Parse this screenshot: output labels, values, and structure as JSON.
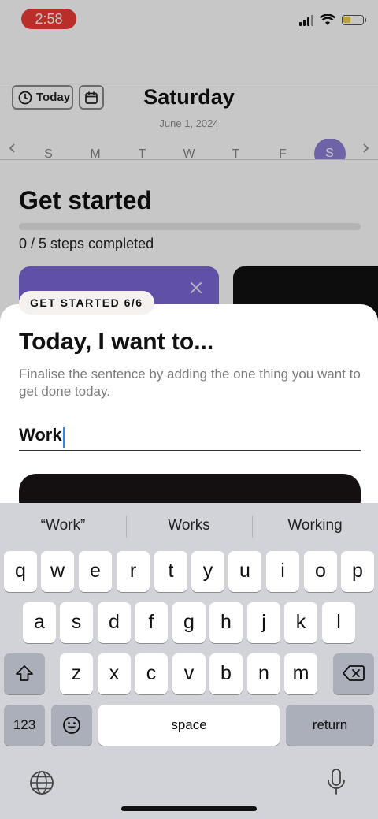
{
  "status": {
    "time": "2:58"
  },
  "header": {
    "today_label": "Today",
    "day_title": "Saturday",
    "date": "June 1, 2024",
    "week_days": [
      "S",
      "M",
      "T",
      "W",
      "T",
      "F",
      "S"
    ],
    "prev_icon": "chevron-left-icon",
    "next_icon": "chevron-right-icon"
  },
  "get_started": {
    "title": "Get started",
    "progress_fraction": 0,
    "steps_text": "0 / 5 steps completed"
  },
  "sheet": {
    "badge": "GET STARTED 6/6",
    "title": "Today, I want to...",
    "description": "Finalise the sentence by adding the one thing you want to get done today.",
    "input_value": "Work"
  },
  "keyboard": {
    "suggestions": [
      "“Work”",
      "Works",
      "Working"
    ],
    "row1": [
      "q",
      "w",
      "e",
      "r",
      "t",
      "y",
      "u",
      "i",
      "o",
      "p"
    ],
    "row2": [
      "a",
      "s",
      "d",
      "f",
      "g",
      "h",
      "j",
      "k",
      "l"
    ],
    "row3": [
      "z",
      "x",
      "c",
      "v",
      "b",
      "n",
      "m"
    ],
    "numbers_label": "123",
    "space_label": "space",
    "return_label": "return"
  },
  "colors": {
    "accent": "#7b68d6",
    "status_red": "#ef3b36",
    "button_dark": "#141012"
  }
}
